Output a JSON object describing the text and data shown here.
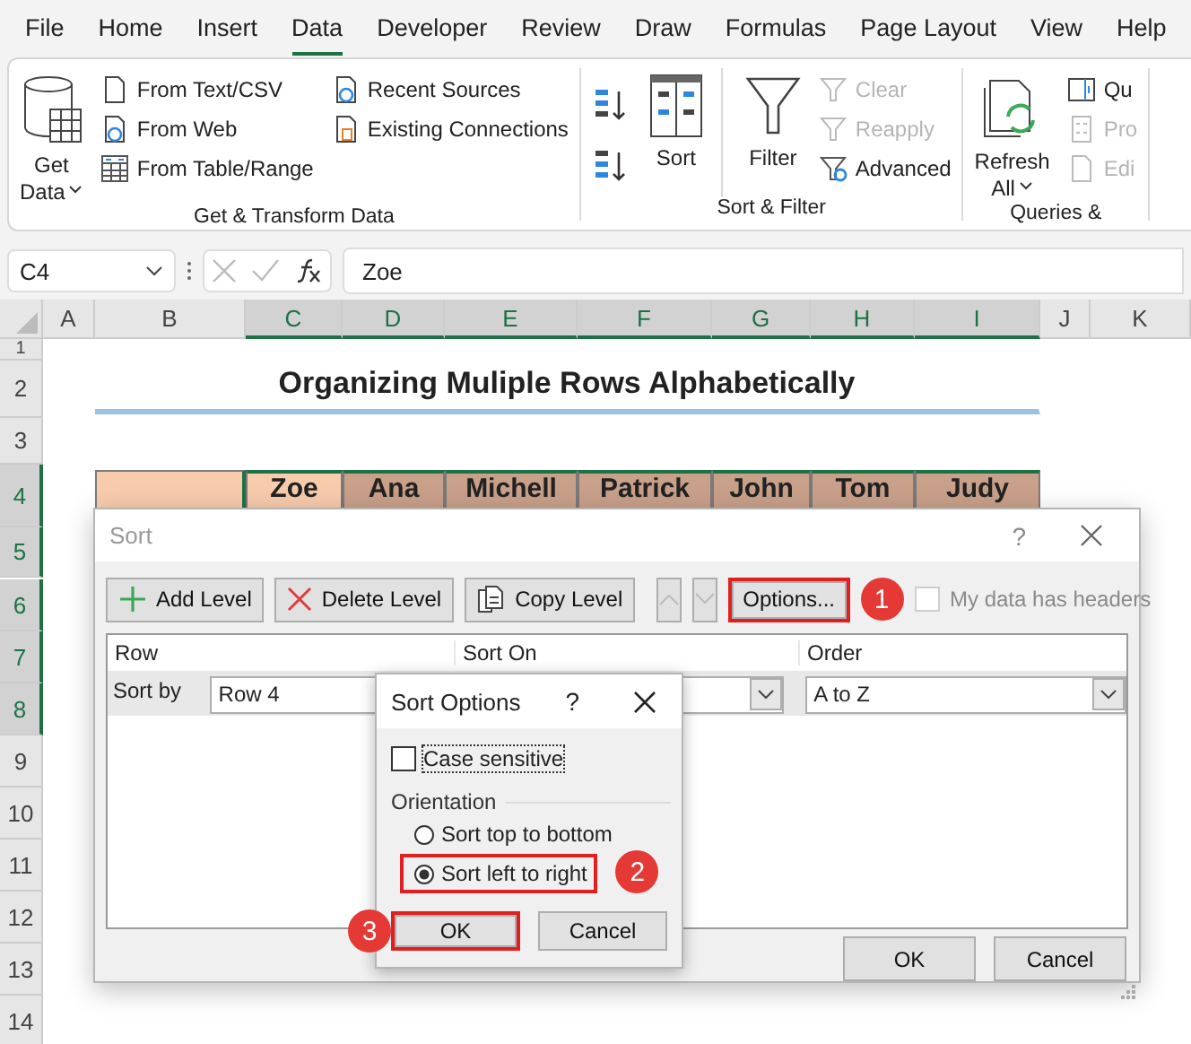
{
  "tabs": [
    {
      "label": "File",
      "selected": false
    },
    {
      "label": "Home",
      "selected": false
    },
    {
      "label": "Insert",
      "selected": false
    },
    {
      "label": "Data",
      "selected": true
    },
    {
      "label": "Developer",
      "selected": false
    },
    {
      "label": "Review",
      "selected": false
    },
    {
      "label": "Draw",
      "selected": false
    },
    {
      "label": "Formulas",
      "selected": false
    },
    {
      "label": "Page Layout",
      "selected": false
    },
    {
      "label": "View",
      "selected": false
    },
    {
      "label": "Help",
      "selected": false
    }
  ],
  "ribbon": [
    {
      "label": "Get & Transform Data",
      "columns": [
        {
          "kind": "large",
          "lines": [
            "Get",
            "Data"
          ],
          "dropdown": true
        },
        {
          "kind": "small",
          "items": [
            {
              "label": "From Text/CSV",
              "disabled": false
            },
            {
              "label": "From Web",
              "disabled": false
            },
            {
              "label": "From Table/Range",
              "disabled": false
            }
          ]
        },
        {
          "kind": "small",
          "items": [
            {
              "label": "Recent Sources",
              "disabled": false
            },
            {
              "label": "Existing Connections",
              "disabled": false
            }
          ]
        }
      ]
    },
    {
      "label": "Sort & Filter",
      "columns": [
        {
          "kind": "sort-buttons"
        },
        {
          "kind": "large",
          "lines": [
            "Sort"
          ],
          "dropdown": false
        },
        {
          "kind": "large",
          "lines": [
            "Filter"
          ],
          "dropdown": false
        },
        {
          "kind": "small",
          "items": [
            {
              "label": "Clear",
              "disabled": true
            },
            {
              "label": "Reapply",
              "disabled": true
            },
            {
              "label": "Advanced",
              "disabled": false
            }
          ]
        }
      ]
    },
    {
      "label": "Queries &",
      "columns": [
        {
          "kind": "large",
          "lines": [
            "Refresh",
            "All"
          ],
          "dropdown": true
        },
        {
          "kind": "small",
          "items": [
            {
              "label": "Qu",
              "disabled": false
            },
            {
              "label": "Pro",
              "disabled": true
            },
            {
              "label": "Edi",
              "disabled": true
            }
          ]
        }
      ]
    }
  ],
  "name_box": "C4",
  "formula": "Zoe",
  "columns": [
    {
      "label": "A",
      "selected": false
    },
    {
      "label": "B",
      "selected": false
    },
    {
      "label": "C",
      "selected": true
    },
    {
      "label": "D",
      "selected": true
    },
    {
      "label": "E",
      "selected": true
    },
    {
      "label": "F",
      "selected": true
    },
    {
      "label": "G",
      "selected": true
    },
    {
      "label": "H",
      "selected": true
    },
    {
      "label": "I",
      "selected": true
    },
    {
      "label": "J",
      "selected": false
    },
    {
      "label": "K",
      "selected": false
    }
  ],
  "rows": [
    {
      "label": "1",
      "selected": false
    },
    {
      "label": "2",
      "selected": false
    },
    {
      "label": "3",
      "selected": false
    },
    {
      "label": "4",
      "selected": true
    },
    {
      "label": "5",
      "selected": true
    },
    {
      "label": "6",
      "selected": true
    },
    {
      "label": "7",
      "selected": true
    },
    {
      "label": "8",
      "selected": true
    },
    {
      "label": "9",
      "selected": false
    },
    {
      "label": "10",
      "selected": false
    },
    {
      "label": "11",
      "selected": false
    },
    {
      "label": "12",
      "selected": false
    },
    {
      "label": "13",
      "selected": false
    },
    {
      "label": "14",
      "selected": false
    }
  ],
  "sheet_title": "Organizing Muliple Rows Alphabetically",
  "header_cells": [
    {
      "text": "Zoe",
      "active": true
    },
    {
      "text": "Ana",
      "active": false
    },
    {
      "text": "Michell",
      "active": false
    },
    {
      "text": "Patrick",
      "active": false
    },
    {
      "text": "John",
      "active": false
    },
    {
      "text": "Tom",
      "active": false
    },
    {
      "text": "Judy",
      "active": false
    }
  ],
  "sort_dialog": {
    "title": "Sort",
    "help": "?",
    "toolbar": [
      {
        "label": "Add Level",
        "kind": "add"
      },
      {
        "label": "Delete Level",
        "kind": "delete"
      },
      {
        "label": "Copy Level",
        "kind": "copy"
      }
    ],
    "options": {
      "label": "Options...",
      "highlighted": true,
      "step": "1"
    },
    "headers_checkbox": {
      "label": "My data has headers",
      "checked": false,
      "disabled": true
    },
    "list_columns": [
      "Row",
      "Sort On",
      "Order"
    ],
    "level": {
      "label": "Sort by",
      "row": "Row 4",
      "order": "A to Z"
    },
    "buttons": [
      "OK",
      "Cancel"
    ]
  },
  "options_dialog": {
    "title": "Sort Options",
    "help": "?",
    "case_sensitive": {
      "label": "Case sensitive",
      "checked": false
    },
    "group_label": "Orientation",
    "radios": [
      {
        "label": "Sort top to bottom",
        "selected": false,
        "highlighted": false
      },
      {
        "label": "Sort left to right",
        "selected": true,
        "highlighted": true,
        "step": "2"
      }
    ],
    "buttons": [
      {
        "label": "OK",
        "highlighted": true,
        "step": "3"
      },
      {
        "label": "Cancel",
        "highlighted": false
      }
    ]
  }
}
